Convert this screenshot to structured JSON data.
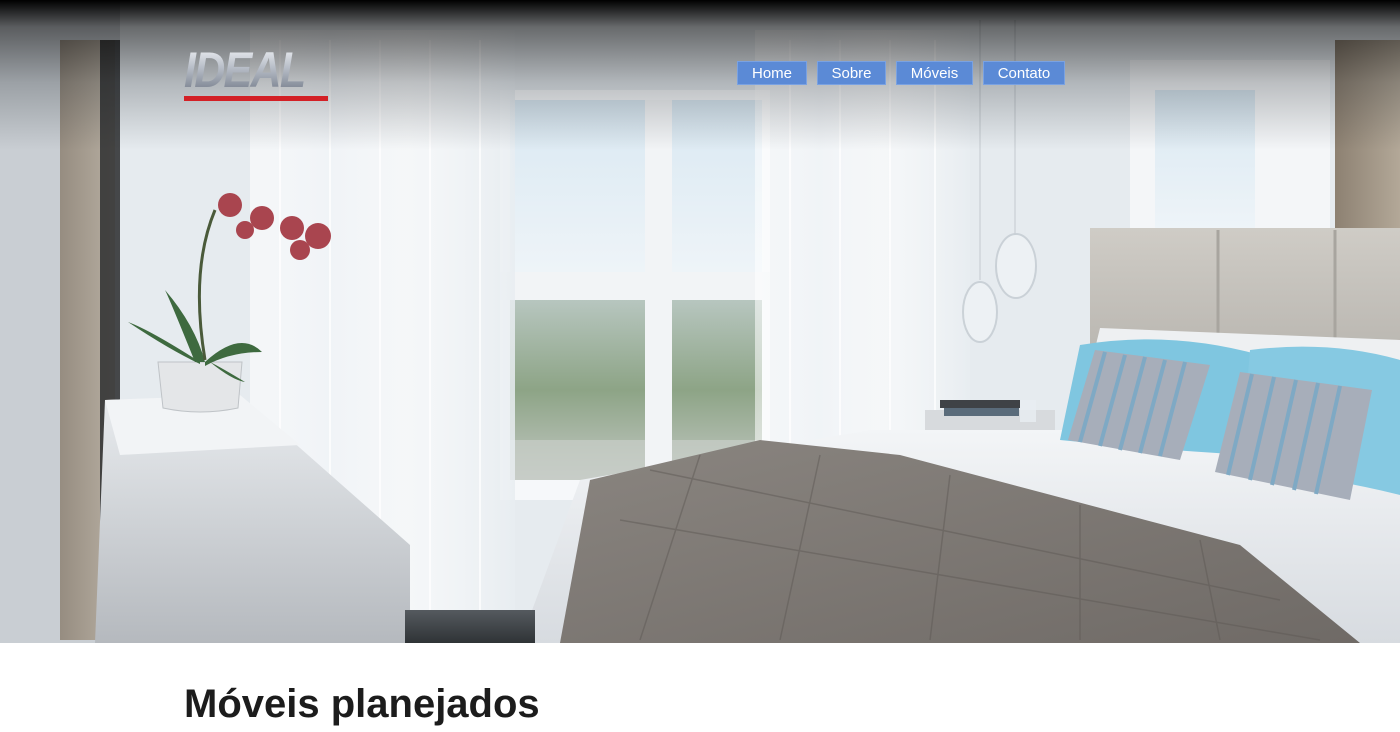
{
  "header": {
    "logo_text": "IDEAL",
    "nav": [
      {
        "label": "Home"
      },
      {
        "label": "Sobre"
      },
      {
        "label": "Móveis"
      },
      {
        "label": "Contato"
      }
    ]
  },
  "main": {
    "section_title": "Móveis planejados"
  },
  "colors": {
    "nav_background": "#5b8ad6",
    "logo_underline": "#d32026",
    "title_text": "#1c1c1c"
  }
}
